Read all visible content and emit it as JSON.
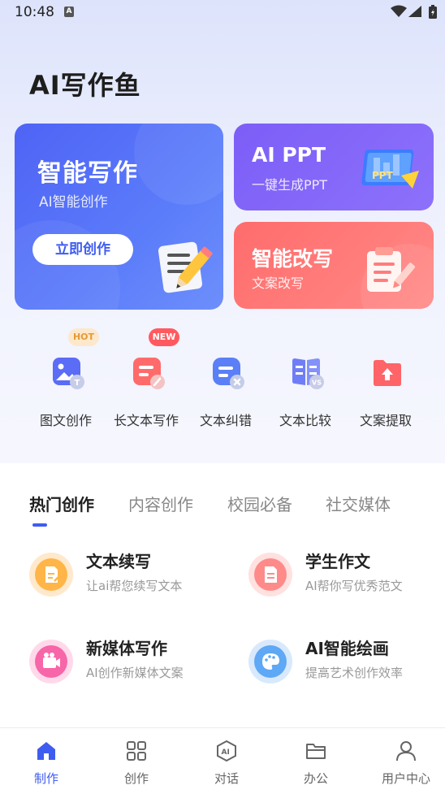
{
  "status": {
    "time": "10:48",
    "notice_icon": "A"
  },
  "app": {
    "title": "AI写作鱼"
  },
  "cards": {
    "writing": {
      "title": "智能写作",
      "subtitle": "AI智能创作",
      "button": "立即创作"
    },
    "ppt": {
      "title": "AI PPT",
      "subtitle": "一键生成PPT",
      "illustration_text": "PPT"
    },
    "rewrite": {
      "title": "智能改写",
      "subtitle": "文案改写"
    }
  },
  "tools": [
    {
      "label": "图文创作",
      "badge": "HOT",
      "icon": "image-text-icon"
    },
    {
      "label": "长文本写作",
      "badge": "NEW",
      "icon": "long-text-icon"
    },
    {
      "label": "文本纠错",
      "icon": "text-correct-icon"
    },
    {
      "label": "文本比较",
      "icon": "text-compare-icon"
    },
    {
      "label": "文案提取",
      "icon": "text-extract-icon"
    }
  ],
  "tabs": [
    "热门创作",
    "内容创作",
    "校园必备",
    "社交媒体"
  ],
  "features": [
    {
      "name": "文本续写",
      "desc": "让ai帮您续写文本",
      "icon": "document-edit-icon",
      "color": "#ffb547"
    },
    {
      "name": "学生作文",
      "desc": "AI帮你写优秀范文",
      "icon": "document-icon",
      "color": "#ff8a8a"
    },
    {
      "name": "新媒体写作",
      "desc": "AI创作新媒体文案",
      "icon": "camera-icon",
      "color": "#f766a8"
    },
    {
      "name": "AI智能绘画",
      "desc": "提高艺术创作效率",
      "icon": "palette-icon",
      "color": "#5ea8f5"
    }
  ],
  "nav": [
    {
      "label": "制作",
      "icon": "home-icon",
      "active": true
    },
    {
      "label": "创作",
      "icon": "grid-icon"
    },
    {
      "label": "对话",
      "icon": "ai-chat-icon"
    },
    {
      "label": "办公",
      "icon": "folder-icon"
    },
    {
      "label": "用户中心",
      "icon": "user-icon"
    }
  ],
  "colors": {
    "primary": "#3f5cf0",
    "ppt": "#7c5ef7",
    "rewrite": "#ff6c6c"
  }
}
